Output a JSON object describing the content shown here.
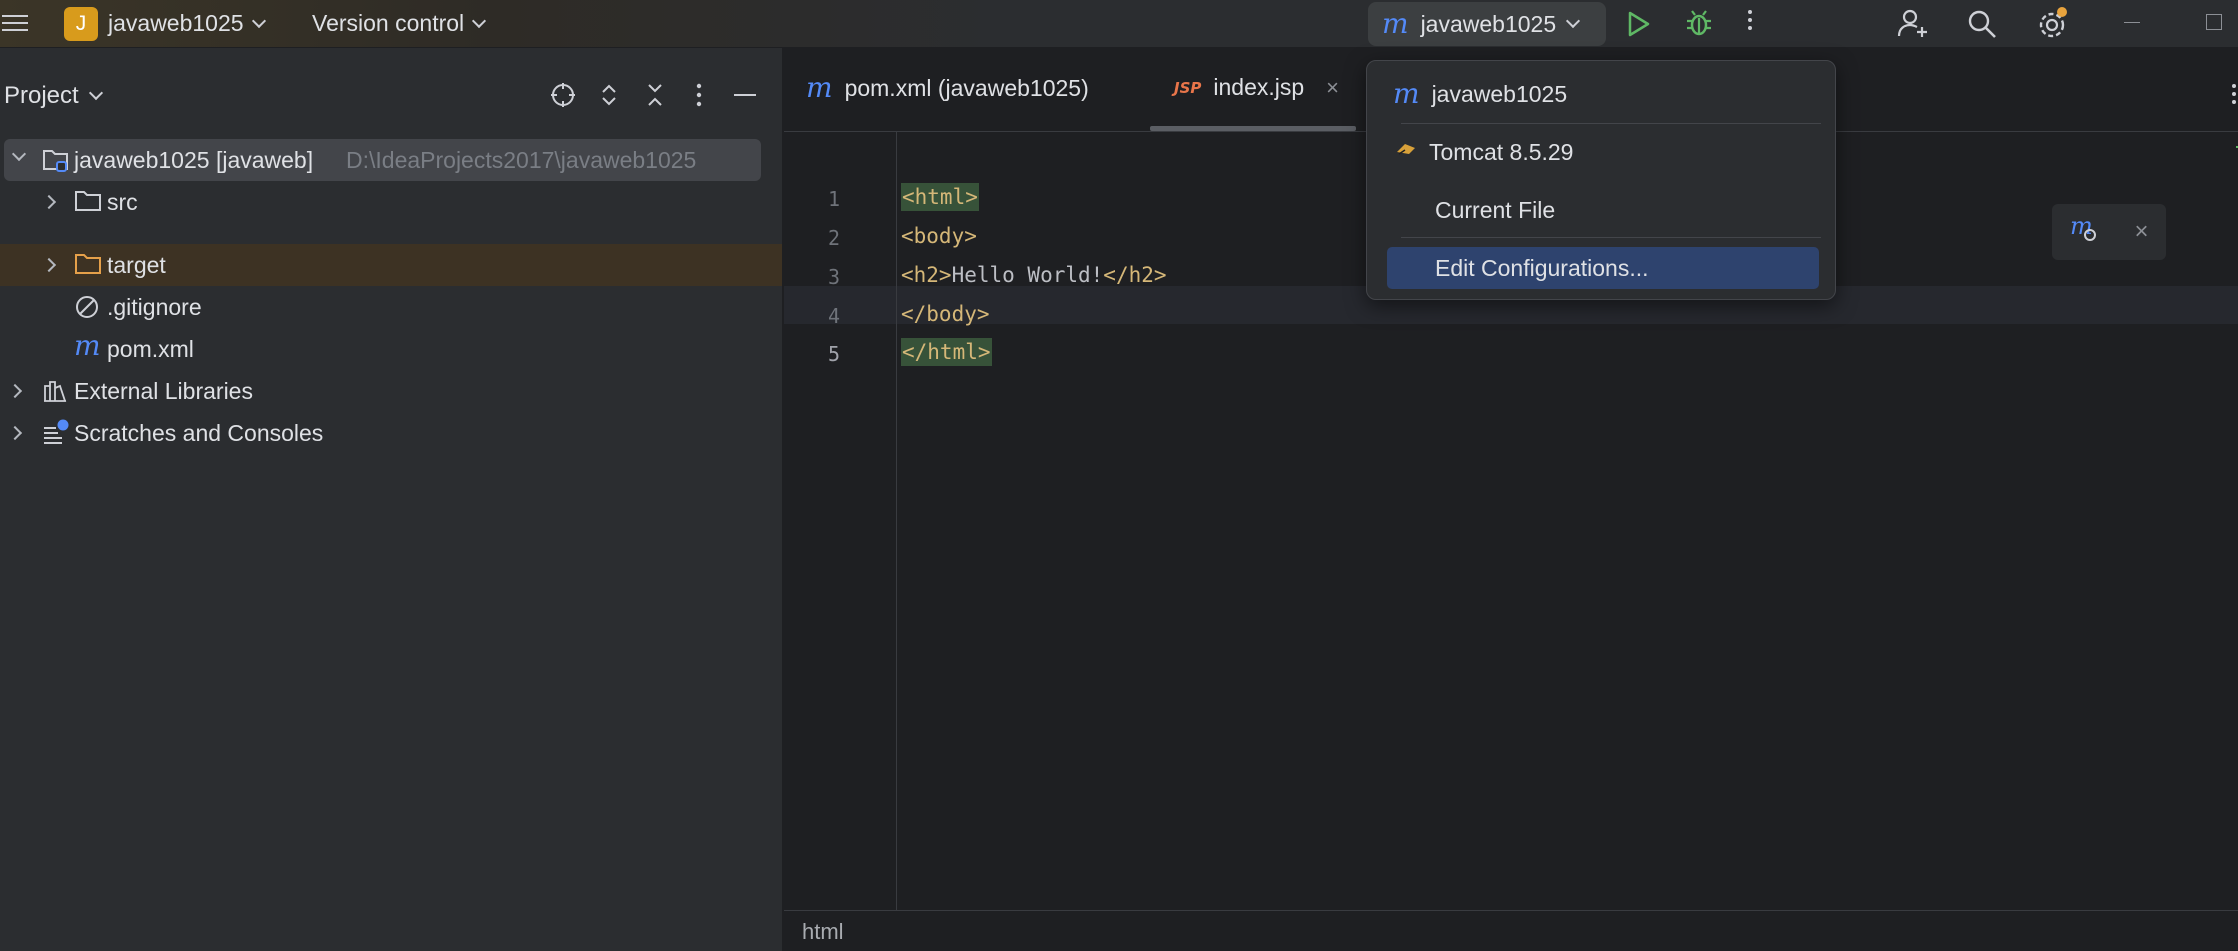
{
  "titlebar": {
    "project_badge": "J",
    "project_name": "javaweb1025",
    "version_control": "Version control",
    "run_config_name": "javaweb1025",
    "icons": [
      "main-menu-icon",
      "run-icon",
      "debug-icon",
      "more-icon",
      "add-user-icon",
      "search-icon",
      "settings-icon",
      "minimize-icon",
      "maximize-icon"
    ]
  },
  "project_panel": {
    "title": "Project",
    "tree": [
      {
        "label": "javaweb1025 [javaweb]",
        "path": "D:\\IdeaProjects2017\\javaweb1025"
      },
      {
        "label": "src"
      },
      {
        "label": "target"
      },
      {
        "label": ".gitignore"
      },
      {
        "label": "pom.xml"
      },
      {
        "label": "External Libraries"
      },
      {
        "label": "Scratches and Consoles"
      }
    ]
  },
  "editor": {
    "tabs": [
      {
        "label": "pom.xml (javaweb1025)",
        "icon": "m"
      },
      {
        "label": "index.jsp",
        "icon": "JSP",
        "active": true
      }
    ],
    "line_numbers": [
      "1",
      "2",
      "3",
      "4",
      "5"
    ],
    "code": {
      "l1": "<html>",
      "l2": "<body>",
      "l3_open": "<h2>",
      "l3_text": "Hello World!",
      "l3_close": "</h2>",
      "l4": "</body>",
      "l5": "</html>"
    },
    "status": "html"
  },
  "dropdown": {
    "items": [
      {
        "label": "javaweb1025"
      },
      {
        "label": "Tomcat 8.5.29"
      },
      {
        "label": "Current File"
      },
      {
        "label": "Edit Configurations...",
        "selected": true
      }
    ]
  },
  "colors": {
    "accent": "#548af7",
    "selection": "#2e436e",
    "run_green": "#5fb865",
    "badge": "#d89b1c",
    "tag": "#d5b778"
  }
}
